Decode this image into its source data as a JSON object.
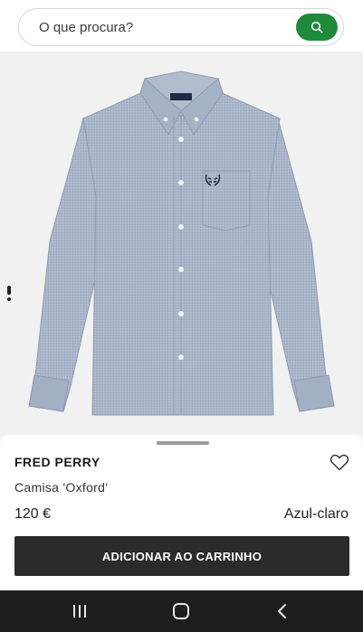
{
  "search": {
    "placeholder": "O que procura?",
    "icon": "search-icon",
    "button_color": "#1f8a3a"
  },
  "product": {
    "brand": "FRED PERRY",
    "name": "Camisa 'Oxford'",
    "price": "120 €",
    "color": "Azul-claro",
    "add_to_cart_label": "ADICIONAR AO CARRINHO",
    "shirt_color": "#a7b4c8",
    "wishlist_icon": "heart-outline-icon"
  },
  "system_nav": {
    "recent_icon": "recent-apps-icon",
    "home_icon": "home-icon",
    "back_icon": "back-icon"
  }
}
